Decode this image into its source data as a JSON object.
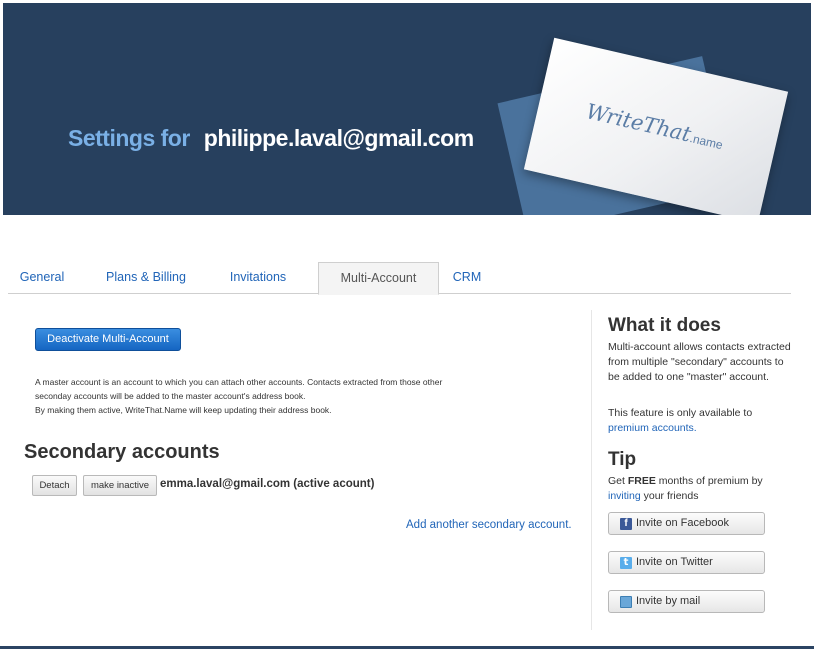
{
  "header": {
    "title_lead": "Settings for",
    "title_email": "philippe.laval@gmail.com",
    "logo_text": "WriteThat",
    "logo_suffix": ".name",
    "bg_color": "#27405e"
  },
  "tabs": [
    {
      "label": "General",
      "active": false
    },
    {
      "label": "Plans & Billing",
      "active": false
    },
    {
      "label": "Invitations",
      "active": false
    },
    {
      "label": "Multi-Account",
      "active": true
    },
    {
      "label": "CRM",
      "active": false
    }
  ],
  "main": {
    "deactivate_label": "Deactivate Multi-Account",
    "description_line1": "A master account is an account to which you can attach other accounts. Contacts extracted from those other",
    "description_line2": "seconday accounts will be added to the master account's address book.",
    "description_line3": "By making them active, WriteThat.Name will keep updating their address book.",
    "secondary_title": "Secondary accounts",
    "accounts": [
      {
        "detach_label": "Detach",
        "toggle_label": "make inactive",
        "email_status": "emma.laval@gmail.com (active acount)"
      }
    ],
    "add_link": "Add another secondary account."
  },
  "sidebar": {
    "what_title": "What it does",
    "what_text": "Multi-account allows contacts extracted from multiple \"secondary\" accounts to be added to one \"master\" account.",
    "availability_text": "This feature is only available to",
    "premium_link": "premium accounts.",
    "tip_title": "Tip",
    "tip_get": "Get",
    "tip_free": "FREE",
    "tip_months": "months of premium by",
    "tip_inviting_link": "inviting",
    "tip_friends": "your friends",
    "buttons": [
      {
        "label": "Invite on Facebook",
        "icon": "facebook-icon"
      },
      {
        "label": "Invite on Twitter",
        "icon": "twitter-icon"
      },
      {
        "label": "Invite by mail",
        "icon": "mail-icon"
      }
    ]
  },
  "colors": {
    "accent": "#2165b8",
    "primary_button": "#1565c2",
    "title_lead": "#7ab0e6"
  }
}
